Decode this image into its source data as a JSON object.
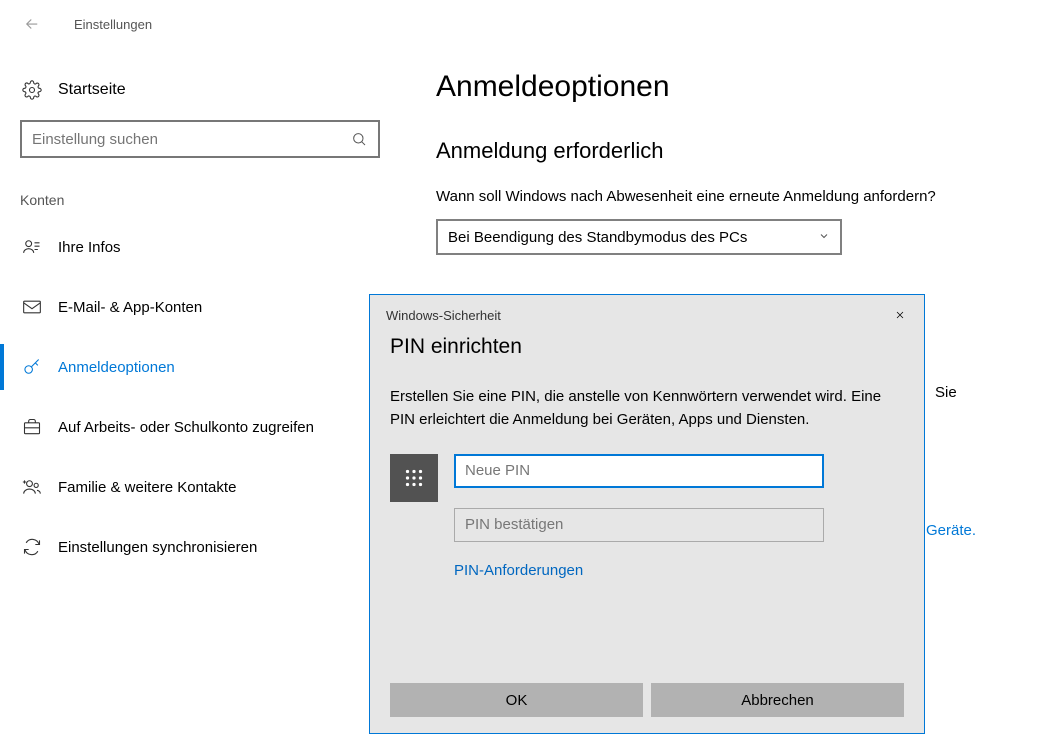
{
  "header": {
    "title": "Einstellungen"
  },
  "sidebar": {
    "home_label": "Startseite",
    "search_placeholder": "Einstellung suchen",
    "section": "Konten",
    "items": [
      {
        "label": "Ihre Infos"
      },
      {
        "label": "E-Mail- & App-Konten"
      },
      {
        "label": "Anmeldeoptionen"
      },
      {
        "label": "Auf Arbeits- oder Schulkonto zugreifen"
      },
      {
        "label": "Familie & weitere Kontakte"
      },
      {
        "label": "Einstellungen synchronisieren"
      }
    ]
  },
  "main": {
    "page_title": "Anmeldeoptionen",
    "section_title": "Anmeldung erforderlich",
    "prompt": "Wann soll Windows nach Abwesenheit eine erneute Anmeldung anfordern?",
    "dropdown_value": "Bei Beendigung des Standbymodus des PCs",
    "peek_text": "Geräte.",
    "peek_text2": "Sie"
  },
  "dialog": {
    "title_small": "Windows-Sicherheit",
    "title": "PIN einrichten",
    "description": "Erstellen Sie eine PIN, die anstelle von Kennwörtern verwendet wird. Eine PIN erleichtert die Anmeldung bei Geräten, Apps und Diensten.",
    "new_pin_placeholder": "Neue PIN",
    "confirm_pin_placeholder": "PIN bestätigen",
    "requirements_link": "PIN-Anforderungen",
    "ok_label": "OK",
    "cancel_label": "Abbrechen"
  }
}
